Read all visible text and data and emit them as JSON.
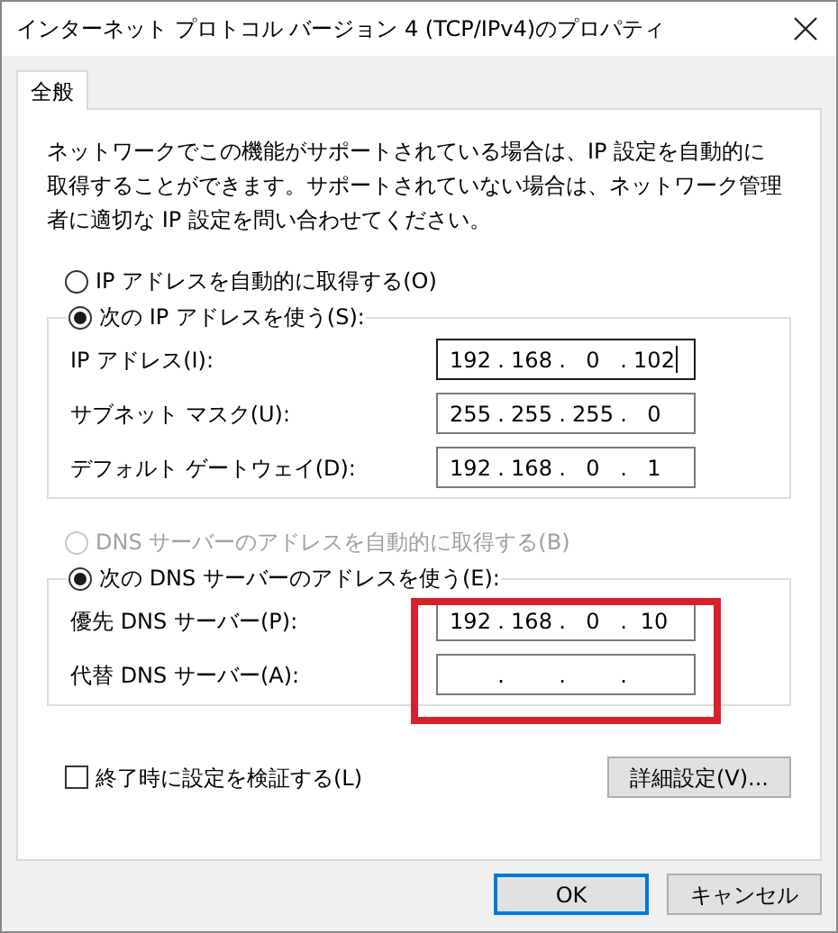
{
  "window": {
    "title": "インターネット プロトコル バージョン 4 (TCP/IPv4)のプロパティ"
  },
  "tabs": [
    {
      "label": "全般",
      "selected": true
    }
  ],
  "description": "ネットワークでこの機能がサポートされている場合は、IP 設定を自動的に取得することができます。サポートされていない場合は、ネットワーク管理者に適切な IP 設定を問い合わせてください。",
  "ip_separator": ".",
  "ip_section": {
    "auto_option": {
      "label": "IP アドレスを自動的に取得する(O)",
      "selected": false,
      "disabled": false
    },
    "manual_option": {
      "label": "次の IP アドレスを使う(S):",
      "selected": true,
      "disabled": false
    },
    "fields": [
      {
        "label": "IP アドレス(I):",
        "octets": [
          "192",
          "168",
          "0",
          "102"
        ],
        "focused": true
      },
      {
        "label": "サブネット マスク(U):",
        "octets": [
          "255",
          "255",
          "255",
          "0"
        ],
        "focused": false
      },
      {
        "label": "デフォルト ゲートウェイ(D):",
        "octets": [
          "192",
          "168",
          "0",
          "1"
        ],
        "focused": false
      }
    ]
  },
  "dns_section": {
    "auto_option": {
      "label": "DNS サーバーのアドレスを自動的に取得する(B)",
      "selected": false,
      "disabled": true
    },
    "manual_option": {
      "label": "次の DNS サーバーのアドレスを使う(E):",
      "selected": true,
      "disabled": false
    },
    "fields": [
      {
        "label": "優先 DNS サーバー(P):",
        "octets": [
          "192",
          "168",
          "0",
          "10"
        ],
        "focused": false
      },
      {
        "label": "代替 DNS サーバー(A):",
        "focused": false
      }
    ]
  },
  "validate_checkbox": {
    "label": "終了時に設定を検証する(L)",
    "checked": false
  },
  "advanced_button": {
    "label": "詳細設定(V)..."
  },
  "buttons": [
    {
      "label": "OK",
      "default": true
    },
    {
      "label": "キャンセル",
      "default": false
    }
  ]
}
